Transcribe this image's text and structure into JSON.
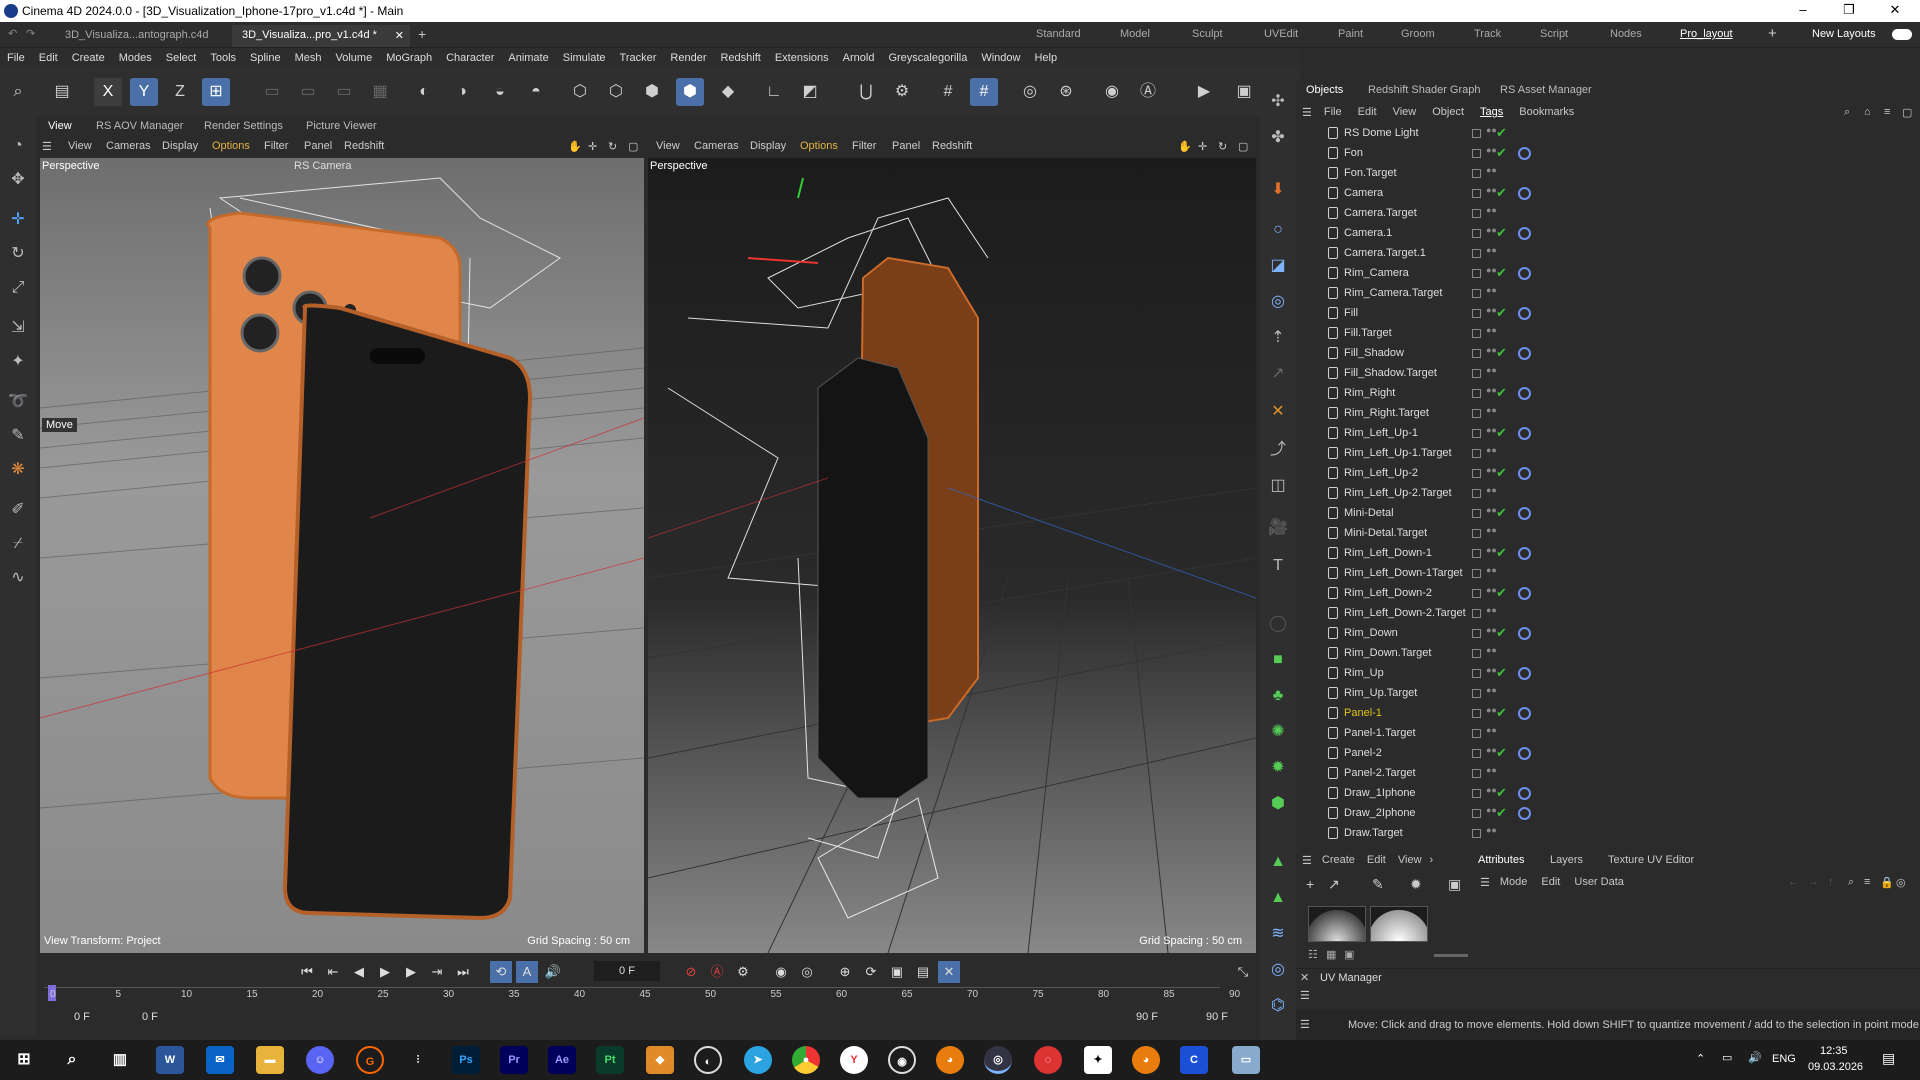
{
  "window": {
    "title": "Cinema 4D 2024.0.0 - [3D_Visualization_Iphone-17pro_v1.c4d *] - Main"
  },
  "doc_tabs": [
    "3D_Visualiza...antograph.c4d",
    "3D_Visualiza...pro_v1.c4d *"
  ],
  "layouts": [
    "Standard",
    "Model",
    "Sculpt",
    "UVEdit",
    "Paint",
    "Groom",
    "Track",
    "Script",
    "Nodes",
    "Pro_layout"
  ],
  "new_layouts": "New Layouts",
  "menu": [
    "File",
    "Edit",
    "Create",
    "Modes",
    "Select",
    "Tools",
    "Spline",
    "Mesh",
    "Volume",
    "MoGraph",
    "Character",
    "Animate",
    "Simulate",
    "Tracker",
    "Render",
    "Redshift",
    "Extensions",
    "Arnold",
    "Greyscalegorilla",
    "Window",
    "Help"
  ],
  "toolbar_axis": [
    "X",
    "Y",
    "Z"
  ],
  "view_tabs": [
    "View",
    "RS AOV Manager",
    "Render Settings",
    "Picture Viewer"
  ],
  "viewport_menu": [
    "View",
    "Cameras",
    "Display",
    "Options",
    "Filter",
    "Panel",
    "Redshift"
  ],
  "viewports": [
    {
      "label": "Perspective",
      "camera": "RS Camera",
      "grid": "Grid Spacing : 50 cm",
      "transform": "View Transform: Project",
      "tool": "Move"
    },
    {
      "label": "Perspective",
      "grid": "Grid Spacing : 50 cm"
    }
  ],
  "objects_tabs": [
    "Objects",
    "Redshift Shader Graph",
    "RS Asset Manager"
  ],
  "objects_menu": [
    "File",
    "Edit",
    "View",
    "Object",
    "Tags",
    "Bookmarks"
  ],
  "objects": [
    {
      "name": "RS Dome Light",
      "check": true,
      "target": false
    },
    {
      "name": "Fon",
      "check": true,
      "target": true
    },
    {
      "name": "Fon.Target",
      "check": false,
      "target": false
    },
    {
      "name": "Camera",
      "check": true,
      "target": true
    },
    {
      "name": "Camera.Target",
      "check": false,
      "target": false
    },
    {
      "name": "Camera.1",
      "check": true,
      "target": true
    },
    {
      "name": "Camera.Target.1",
      "check": false,
      "target": false
    },
    {
      "name": "Rim_Camera",
      "check": true,
      "target": true
    },
    {
      "name": "Rim_Camera.Target",
      "check": false,
      "target": false
    },
    {
      "name": "Fill",
      "check": true,
      "target": true
    },
    {
      "name": "Fill.Target",
      "check": false,
      "target": false
    },
    {
      "name": "Fill_Shadow",
      "check": true,
      "target": true
    },
    {
      "name": "Fill_Shadow.Target",
      "check": false,
      "target": false
    },
    {
      "name": "Rim_Right",
      "check": true,
      "target": true
    },
    {
      "name": "Rim_Right.Target",
      "check": false,
      "target": false
    },
    {
      "name": "Rim_Left_Up-1",
      "check": true,
      "target": true
    },
    {
      "name": "Rim_Left_Up-1.Target",
      "check": false,
      "target": false
    },
    {
      "name": "Rim_Left_Up-2",
      "check": true,
      "target": true
    },
    {
      "name": "Rim_Left_Up-2.Target",
      "check": false,
      "target": false
    },
    {
      "name": "Mini-Detal",
      "check": true,
      "target": true
    },
    {
      "name": "Mini-Detal.Target",
      "check": false,
      "target": false
    },
    {
      "name": "Rim_Left_Down-1",
      "check": true,
      "target": true
    },
    {
      "name": "Rim_Left_Down-1Target",
      "check": false,
      "target": false
    },
    {
      "name": "Rim_Left_Down-2",
      "check": true,
      "target": true
    },
    {
      "name": "Rim_Left_Down-2.Target",
      "check": false,
      "target": false
    },
    {
      "name": "Rim_Down",
      "check": true,
      "target": true
    },
    {
      "name": "Rim_Down.Target",
      "check": false,
      "target": false
    },
    {
      "name": "Rim_Up",
      "check": true,
      "target": true
    },
    {
      "name": "Rim_Up.Target",
      "check": false,
      "target": false
    },
    {
      "name": "Panel-1",
      "check": true,
      "target": true,
      "highlight": true
    },
    {
      "name": "Panel-1.Target",
      "check": false,
      "target": false
    },
    {
      "name": "Panel-2",
      "check": true,
      "target": true
    },
    {
      "name": "Panel-2.Target",
      "check": false,
      "target": false
    },
    {
      "name": "Draw_1Iphone",
      "check": true,
      "target": true
    },
    {
      "name": "Draw_2Iphone",
      "check": true,
      "target": true
    },
    {
      "name": "Draw.Target",
      "check": false,
      "target": false
    }
  ],
  "material_menu": [
    "Create",
    "Edit",
    "View"
  ],
  "attr_tabs": [
    "Attributes",
    "Layers",
    "Texture UV Editor"
  ],
  "attr_menu": [
    "Mode",
    "Edit",
    "User Data"
  ],
  "uv_manager": "UV Manager",
  "timeline": {
    "current": "0 F",
    "start": "0 F",
    "start2": "0 F",
    "end": "90 F",
    "end2": "90 F",
    "ticks": [
      "0",
      "5",
      "10",
      "15",
      "20",
      "25",
      "30",
      "35",
      "40",
      "45",
      "50",
      "55",
      "60",
      "65",
      "70",
      "75",
      "80",
      "85",
      "90"
    ]
  },
  "status": "Move: Click and drag to move elements. Hold down SHIFT to quantize movement / add to the selection in point mode",
  "clock": {
    "time": "12:35",
    "date": "09.03.2026",
    "lang": "ENG"
  },
  "taskbar_apps": [
    "W",
    "Ps",
    "Pr",
    "Ae",
    "Pt"
  ]
}
